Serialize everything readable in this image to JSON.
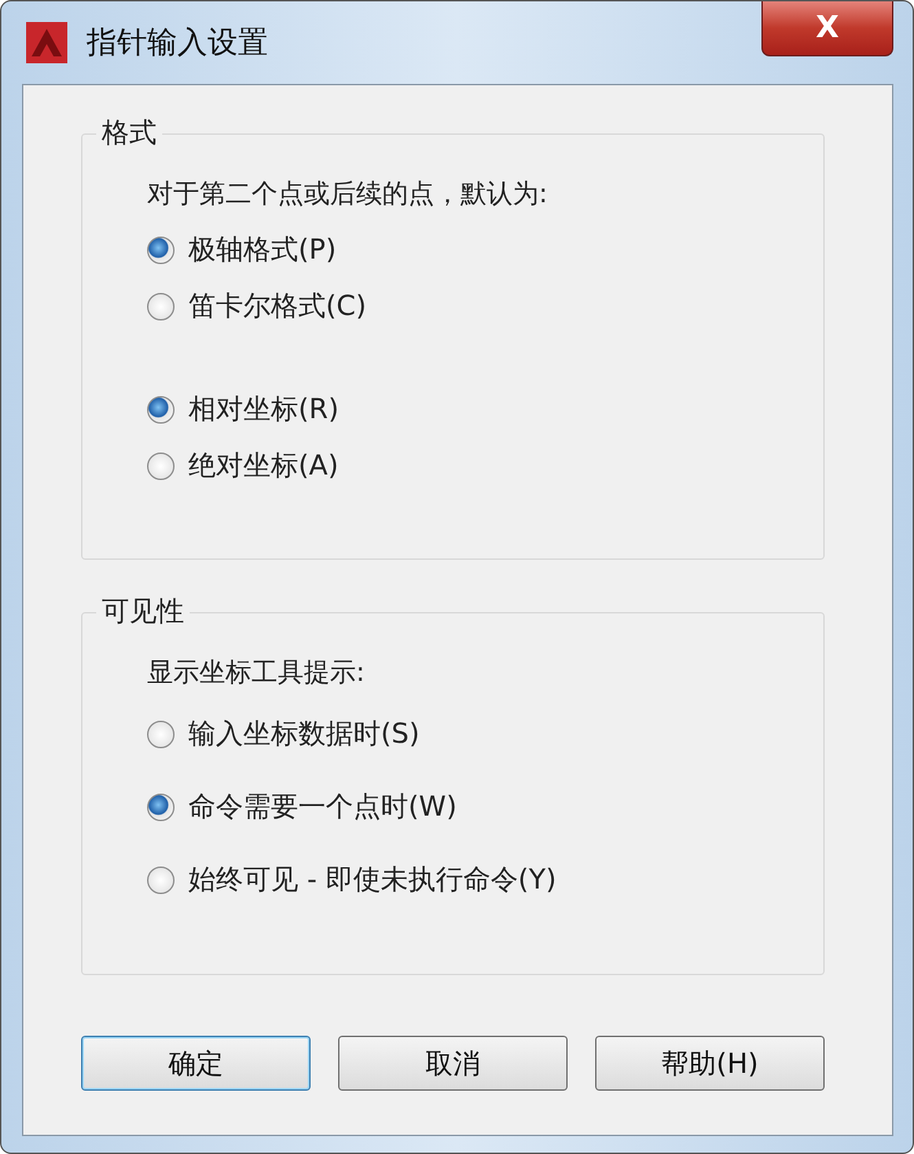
{
  "window": {
    "title": "指针输入设置",
    "close_label": "X"
  },
  "sections": [
    {
      "title": "格式",
      "prompt": "对于第二个点或后续的点，默认为:",
      "radio_sets": [
        [
          {
            "label": "极轴格式(P)",
            "selected": true
          },
          {
            "label": "笛卡尔格式(C)",
            "selected": false
          }
        ],
        [
          {
            "label": "相对坐标(R)",
            "selected": true
          },
          {
            "label": "绝对坐标(A)",
            "selected": false
          }
        ]
      ]
    },
    {
      "title": "可见性",
      "prompt": "显示坐标工具提示:",
      "radio_sets": [
        [
          {
            "label": "输入坐标数据时(S)",
            "selected": false
          },
          {
            "label": "命令需要一个点时(W)",
            "selected": true
          },
          {
            "label": "始终可见 - 即使未执行命令(Y)",
            "selected": false
          }
        ]
      ]
    }
  ],
  "buttons": [
    {
      "label": "确定",
      "default": true
    },
    {
      "label": "取消",
      "default": false
    },
    {
      "label": "帮助(H)",
      "default": false
    }
  ]
}
